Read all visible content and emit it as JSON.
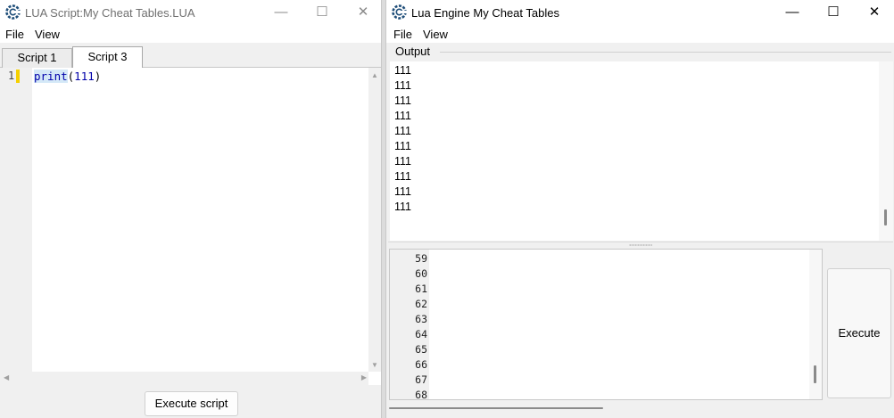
{
  "left_window": {
    "title": "LUA Script:My Cheat Tables.LUA",
    "controls": {
      "minimize": "—",
      "maximize": "☐",
      "close": "✕"
    },
    "menu": [
      "File",
      "View"
    ],
    "tabs": [
      {
        "label": "Script  1",
        "active": false
      },
      {
        "label": "Script  3",
        "active": true
      }
    ],
    "editor": {
      "line_numbers": [
        "1"
      ],
      "code_keyword": "print",
      "code_paren_open": "(",
      "code_number": "111",
      "code_paren_close": ")"
    },
    "execute_button": "Execute script"
  },
  "right_window": {
    "title": "Lua Engine My Cheat Tables",
    "controls": {
      "minimize": "—",
      "maximize": "☐",
      "close": "✕"
    },
    "menu": [
      "File",
      "View"
    ],
    "output_label": "Output",
    "output_lines": [
      "111",
      "111",
      "111",
      "111",
      "111",
      "111",
      "111",
      "111",
      "111",
      "111"
    ],
    "input_line_numbers": [
      "59",
      "60",
      "61",
      "62",
      "63",
      "64",
      "65",
      "66",
      "67",
      "68"
    ],
    "execute_button": "Execute"
  },
  "colors": {
    "app_icon": "#1f4e79",
    "keyword": "#0000aa",
    "change_marker": "#f5d000"
  }
}
